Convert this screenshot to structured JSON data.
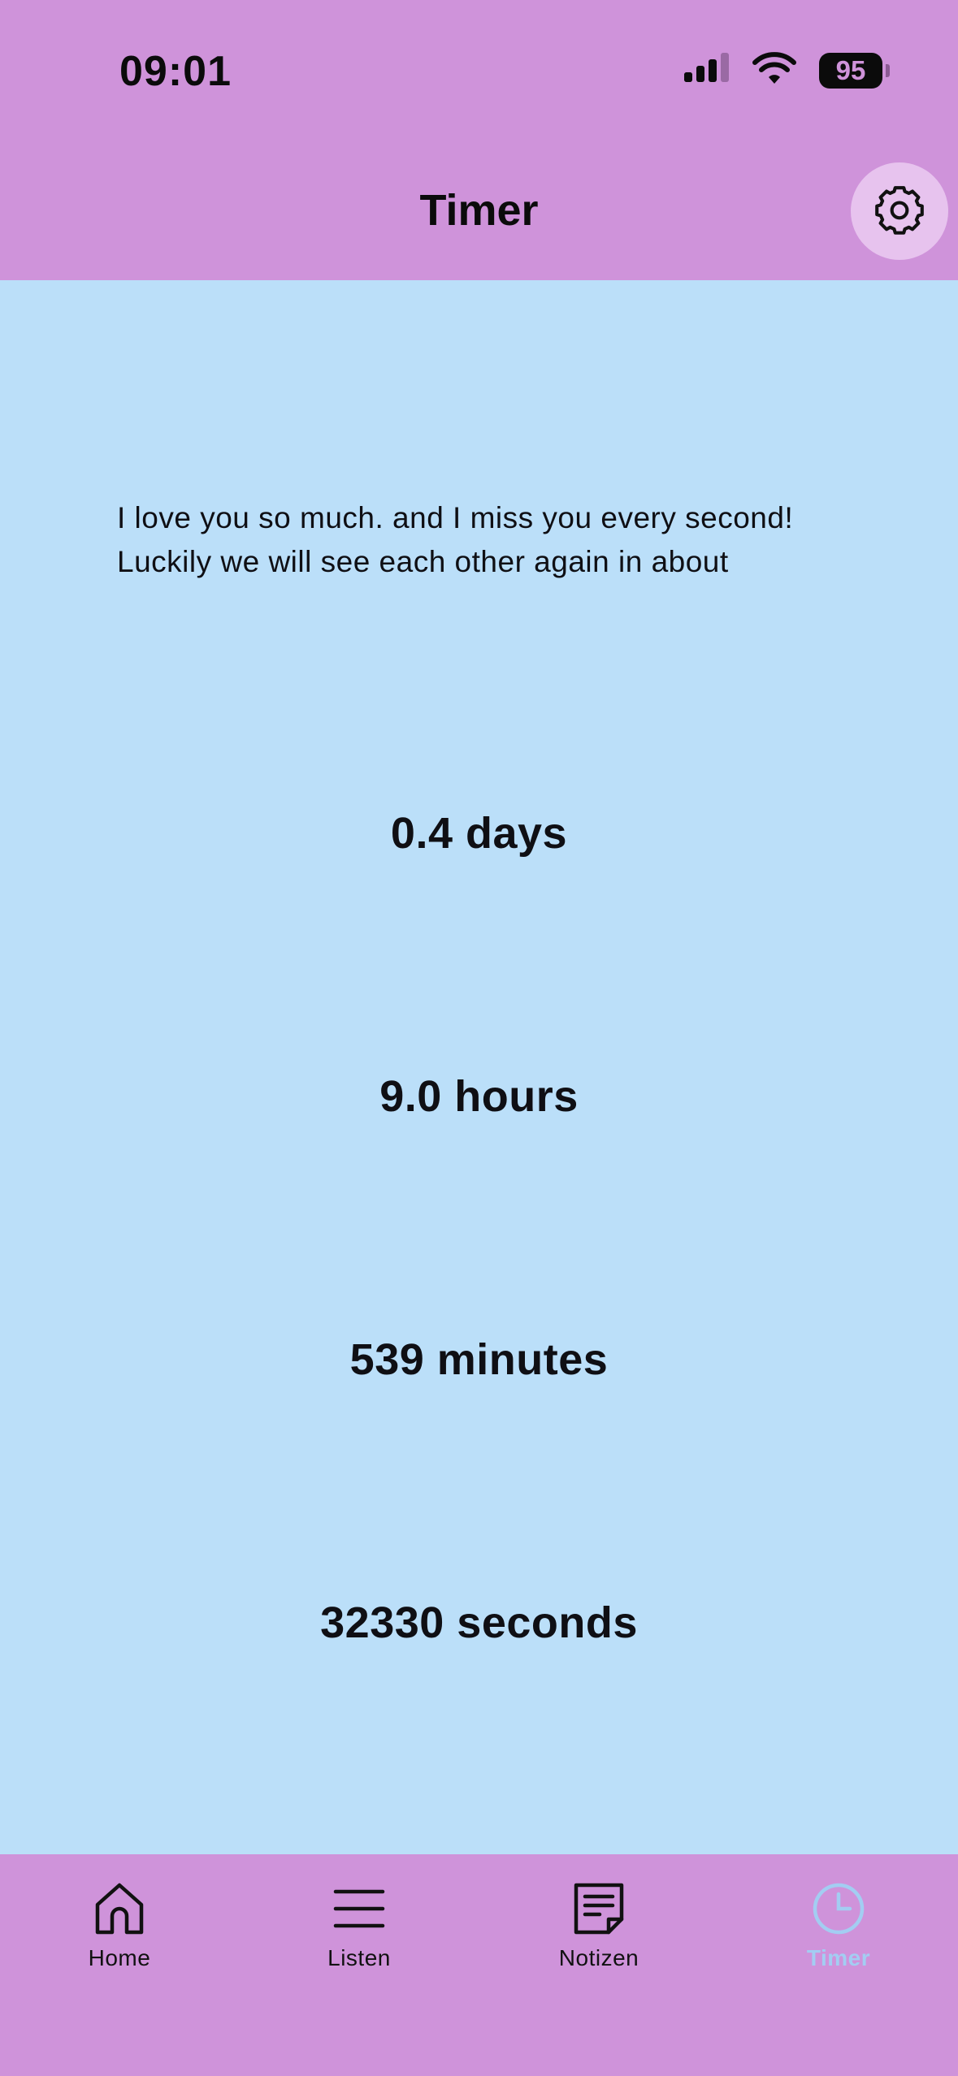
{
  "status_bar": {
    "time": "09:01",
    "battery": "95",
    "icons": [
      "signal-icon",
      "wifi-icon",
      "battery-icon"
    ]
  },
  "app_bar": {
    "title": "Timer",
    "settings_icon": "gear-icon"
  },
  "main": {
    "message_line1": "I love you so much. and I miss you every second!",
    "message_line2": "Luckily we will see each other again in about",
    "days": "0.4 days",
    "hours": "9.0 hours",
    "minutes": "539 minutes",
    "seconds": "32330 seconds"
  },
  "nav": {
    "items": [
      {
        "label": "Home",
        "icon": "home-icon"
      },
      {
        "label": "Listen",
        "icon": "menu-icon"
      },
      {
        "label": "Notizen",
        "icon": "note-icon"
      },
      {
        "label": "Timer",
        "icon": "clock-icon"
      }
    ],
    "active_index": 3
  },
  "colors": {
    "bars": "#cf93da",
    "background": "#bbdff9",
    "active_tab": "#a3cdf2",
    "settings_button": "#e7c3ee"
  }
}
